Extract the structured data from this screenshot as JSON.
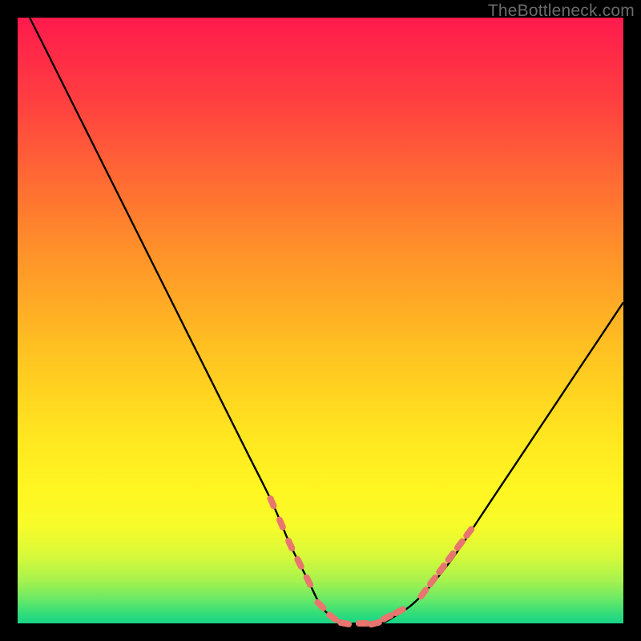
{
  "watermark": "TheBottleneck.com",
  "colors": {
    "frame": "#000000",
    "curve": "#000000",
    "marker": "#e9766e",
    "gradient_top": "#ff1a4d",
    "gradient_bottom": "#17d588"
  },
  "chart_data": {
    "type": "line",
    "title": "",
    "xlabel": "",
    "ylabel": "",
    "xlim": [
      0,
      100
    ],
    "ylim": [
      0,
      100
    ],
    "series": [
      {
        "name": "bottleneck-curve",
        "x": [
          2,
          6,
          10,
          14,
          18,
          22,
          26,
          30,
          34,
          38,
          42,
          45,
          48,
          50,
          52,
          54,
          56,
          58,
          60,
          62,
          65,
          68,
          72,
          76,
          80,
          84,
          88,
          92,
          96,
          100
        ],
        "y": [
          100,
          92,
          84,
          76,
          68,
          60,
          52,
          44,
          36,
          28,
          20,
          13,
          7,
          3,
          1,
          0,
          0,
          0,
          0,
          1,
          3,
          6,
          11,
          17,
          23,
          29,
          35,
          41,
          47,
          53
        ]
      }
    ],
    "markers": {
      "left_arm": {
        "x": [
          42,
          43.5,
          45,
          46.5,
          48
        ],
        "y": [
          20,
          16.5,
          13,
          10,
          7
        ]
      },
      "floor": {
        "x": [
          50,
          52,
          54,
          57,
          59,
          61,
          63
        ],
        "y": [
          3,
          1,
          0,
          0,
          0,
          1,
          2
        ]
      },
      "right_arm": {
        "x": [
          67,
          68.5,
          70,
          71.5,
          73,
          74.5
        ],
        "y": [
          5,
          7,
          9,
          11,
          13,
          15
        ]
      }
    }
  }
}
